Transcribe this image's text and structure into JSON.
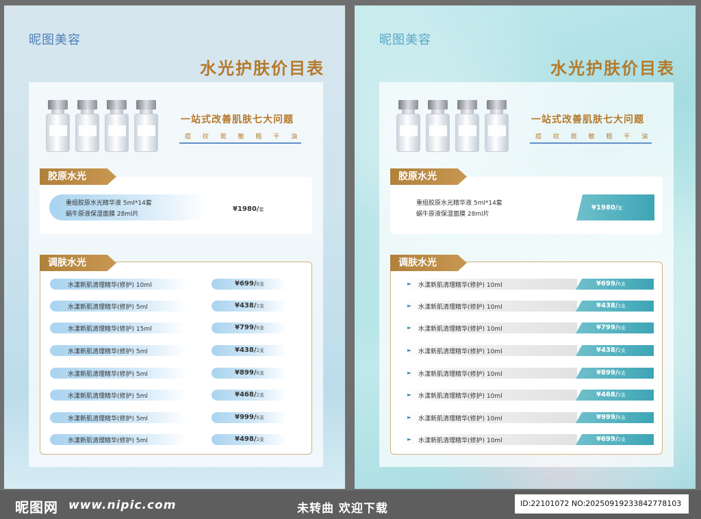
{
  "posters": [
    {
      "brand": "昵图美容",
      "title": "水光护肤价目表",
      "slogan": "一站式改善肌肤七大问题",
      "effects": "痘 纹 斑 敏 粗 干 油",
      "collagen": {
        "tag": "胶原水光",
        "line1": "重组胶原水光精华液 5ml*14套",
        "line2": "蜗牛原液保湿面膜 28ml片",
        "price": "¥1980/",
        "unit": "套"
      },
      "adjust": {
        "tag": "调肤水光",
        "items": [
          {
            "name": "水漾新肌清理精华(修护) 10ml",
            "price": "¥699/",
            "unit": "6支"
          },
          {
            "name": "水漾新肌清理精华(修护) 5ml",
            "price": "¥438/",
            "unit": "2支"
          },
          {
            "name": "水漾新肌清理精华(修护) 15ml",
            "price": "¥799/",
            "unit": "6支"
          },
          {
            "name": "水漾新肌清理精华(修护) 5ml",
            "price": "¥438/",
            "unit": "2支"
          },
          {
            "name": "水漾新肌清理精华(修护) 5ml",
            "price": "¥899/",
            "unit": "6支"
          },
          {
            "name": "水漾新肌清理精华(修护) 5ml",
            "price": "¥468/",
            "unit": "2支"
          },
          {
            "name": "水漾新肌清理精华(修护) 5ml",
            "price": "¥999/",
            "unit": "6支"
          },
          {
            "name": "水漾新肌清理精华(修护) 5ml",
            "price": "¥498/",
            "unit": "2支"
          }
        ]
      }
    },
    {
      "brand": "昵图美容",
      "title": "水光护肤价目表",
      "slogan": "一站式改善肌肤七大问题",
      "effects": "痘 纹 斑 敏 粗 干 油",
      "collagen": {
        "tag": "胶原水光",
        "line1": "重组胶原水光精华液 5ml*14套",
        "line2": "蜗牛原液保湿面膜 28ml片",
        "price": "¥1980/",
        "unit": "套"
      },
      "adjust": {
        "tag": "调肤水光",
        "items": [
          {
            "name": "水漾新肌清理精华(修护) 10ml",
            "price": "¥699/",
            "unit": "6支"
          },
          {
            "name": "水漾新肌清理精华(修护) 10ml",
            "price": "¥438/",
            "unit": "2支"
          },
          {
            "name": "水漾新肌清理精华(修护) 10ml",
            "price": "¥799/",
            "unit": "6支"
          },
          {
            "name": "水漾新肌清理精华(修护) 10ml",
            "price": "¥438/",
            "unit": "2支"
          },
          {
            "name": "水漾新肌清理精华(修护) 10ml",
            "price": "¥899/",
            "unit": "6支"
          },
          {
            "name": "水漾新肌清理精华(修护) 10ml",
            "price": "¥468/",
            "unit": "2支"
          },
          {
            "name": "水漾新肌清理精华(修护) 10ml",
            "price": "¥999/",
            "unit": "6支"
          },
          {
            "name": "水漾新肌清理精华(修护) 10ml",
            "price": "¥699/",
            "unit": "2支"
          }
        ]
      }
    }
  ],
  "footer": {
    "logo": "昵图网",
    "url": "www.nipic.com",
    "notice": "未转曲  欢迎下载",
    "id": "ID:22101072 NO:20250919233842778103"
  }
}
